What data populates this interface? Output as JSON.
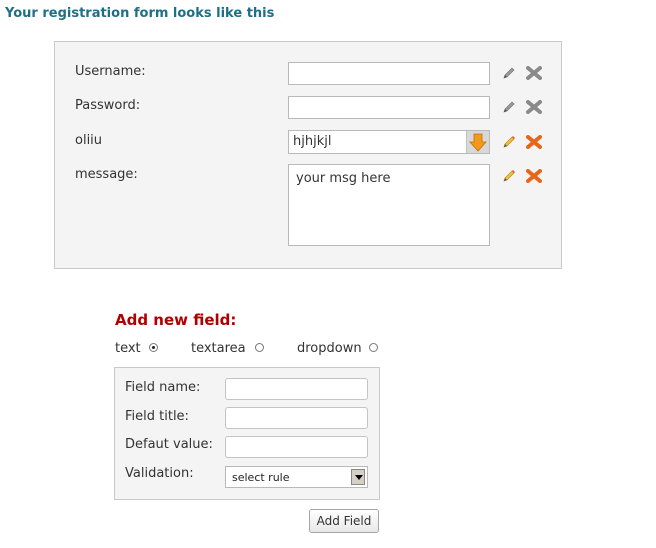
{
  "page": {
    "title": "Your registration form looks like this"
  },
  "preview": {
    "fields": [
      {
        "label": "Username:",
        "type": "text",
        "value": ""
      },
      {
        "label": "Password:",
        "type": "text",
        "value": ""
      },
      {
        "label": "oliiu",
        "type": "dropdown",
        "value": "hjhjkjl"
      },
      {
        "label": "message:",
        "type": "textarea",
        "value": "your msg here"
      }
    ],
    "icons": {
      "edit": "pencil-icon",
      "delete": "x-delete-icon",
      "dropdown": "orange-down-arrow-icon"
    }
  },
  "add_field": {
    "title": "Add new field:",
    "types": [
      {
        "label": "text",
        "selected": true
      },
      {
        "label": "textarea",
        "selected": false
      },
      {
        "label": "dropdown",
        "selected": false
      }
    ],
    "field_name_label": "Field name:",
    "field_title_label": "Field title:",
    "default_value_label": "Defaut value:",
    "validation_label": "Validation:",
    "validation_selected": "select rule",
    "button_label": "Add Field"
  },
  "colors": {
    "title": "#1f6f86",
    "add_title": "#b00000",
    "delete_active": "#e8661b",
    "delete_disabled": "#8a8a8a"
  }
}
